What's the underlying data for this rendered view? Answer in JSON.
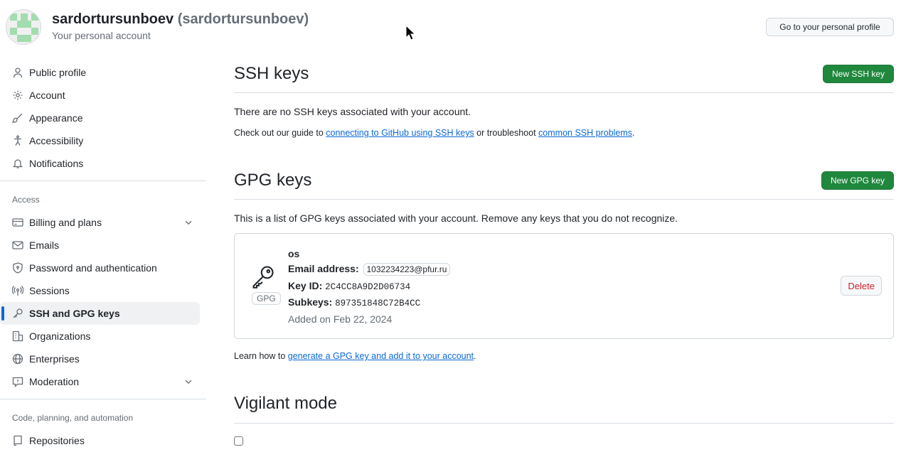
{
  "header": {
    "display_name": "sardortursunboev",
    "login": "(sardortursunboev)",
    "subtitle": "Your personal account",
    "profile_button": "Go to your personal profile"
  },
  "sidebar": {
    "items": [
      {
        "label": "Public profile",
        "icon": "person-icon"
      },
      {
        "label": "Account",
        "icon": "gear-icon"
      },
      {
        "label": "Appearance",
        "icon": "paintbrush-icon"
      },
      {
        "label": "Accessibility",
        "icon": "accessibility-icon"
      },
      {
        "label": "Notifications",
        "icon": "bell-icon"
      }
    ],
    "access_title": "Access",
    "access_items": [
      {
        "label": "Billing and plans",
        "icon": "credit-card-icon",
        "expandable": true
      },
      {
        "label": "Emails",
        "icon": "mail-icon"
      },
      {
        "label": "Password and authentication",
        "icon": "shield-lock-icon"
      },
      {
        "label": "Sessions",
        "icon": "broadcast-icon"
      },
      {
        "label": "SSH and GPG keys",
        "icon": "key-icon",
        "active": true
      },
      {
        "label": "Organizations",
        "icon": "organization-icon"
      },
      {
        "label": "Enterprises",
        "icon": "globe-icon"
      },
      {
        "label": "Moderation",
        "icon": "report-icon",
        "expandable": true
      }
    ],
    "code_title": "Code, planning, and automation",
    "code_items": [
      {
        "label": "Repositories",
        "icon": "repo-icon"
      }
    ]
  },
  "ssh": {
    "title": "SSH keys",
    "new_button": "New SSH key",
    "empty_text": "There are no SSH keys associated with your account.",
    "guide_prefix": "Check out our guide to ",
    "guide_link": "connecting to GitHub using SSH keys",
    "guide_middle": " or troubleshoot ",
    "guide_link2": "common SSH problems",
    "guide_suffix": "."
  },
  "gpg": {
    "title": "GPG keys",
    "new_button": "New GPG key",
    "intro": "This is a list of GPG keys associated with your account. Remove any keys that you do not recognize.",
    "key": {
      "badge": "GPG",
      "name": "os",
      "email_label": "Email address:",
      "email": "1032234223@pfur.ru",
      "keyid_label": "Key ID:",
      "keyid": "2C4CC8A9D2D06734",
      "subkeys_label": "Subkeys:",
      "subkeys": "897351848C72B4CC",
      "added": "Added on Feb 22, 2024",
      "delete_button": "Delete"
    },
    "learn_prefix": "Learn how to ",
    "learn_link": "generate a GPG key and add it to your account",
    "learn_suffix": "."
  },
  "vigilant": {
    "title": "Vigilant mode"
  },
  "colors": {
    "primary_button": "#1f883d",
    "link": "#0969da",
    "danger": "#cf222e",
    "active_indicator": "#0969da"
  }
}
